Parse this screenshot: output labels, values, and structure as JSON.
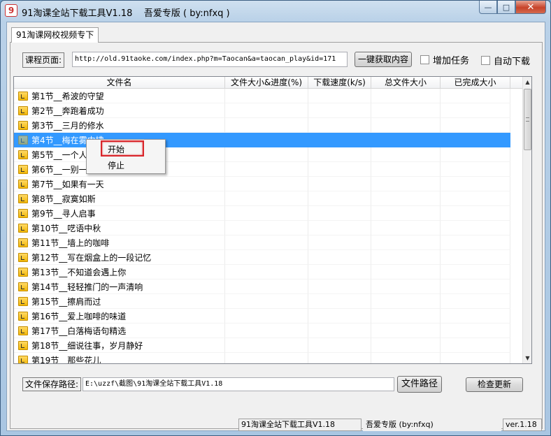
{
  "window": {
    "title": "91淘课全站下载工具V1.18    吾爱专版 ( by:nfxq )",
    "minimize": "—",
    "maximize": "□",
    "close": "✕"
  },
  "tab": {
    "label": "91淘课网校视频专下"
  },
  "url_label": "课程页面:",
  "url_value": "http://old.91taoke.com/index.php?m=Taocan&a=taocan_play&id=171",
  "fetch_button": "一键获取内容",
  "add_task_label": "增加任务",
  "auto_download_label": "自动下载",
  "columns": [
    "文件名",
    "文件大小&进度(%)",
    "下载速度(k/s)",
    "总文件大小",
    "已完成大小"
  ],
  "rows": [
    "第1节__希波的守望",
    "第2节__奔跑着成功",
    "第3节__三月的修水",
    "第4节__梅在雾中拂",
    "第5节__一个人的旅行",
    "第6节__一别一别",
    "第7节__如果有一天",
    "第8节__寂寞如斯",
    "第9节__寻人启事",
    "第10节__呓语中秋",
    "第11节__墙上的咖啡",
    "第12节__写在烟盒上的一段记忆",
    "第13节__不知道会遇上你",
    "第14节__轻轻推门的一声清响",
    "第15节__擦肩而过",
    "第16节__爱上咖啡的味道",
    "第17节__白落梅语句精选",
    "第18节__细说往事，岁月静好",
    "第19节__那些花儿"
  ],
  "selected_row": 3,
  "context_menu": {
    "start": "开始",
    "stop": "停止"
  },
  "save_path_label": "文件保存路径:",
  "save_path_value": "E:\\uzzf\\截图\\91淘课全站下载工具V1.18",
  "file_path_button": "文件路径",
  "check_update_button": "检查更新",
  "status": {
    "left": "91淘课全站下载工具V1.18",
    "middle": "吾爱专版 (by:nfxq)",
    "right": "ver.1.18"
  },
  "colors": {
    "selection": "#3399ff",
    "highlight_box": "#d9262b"
  }
}
